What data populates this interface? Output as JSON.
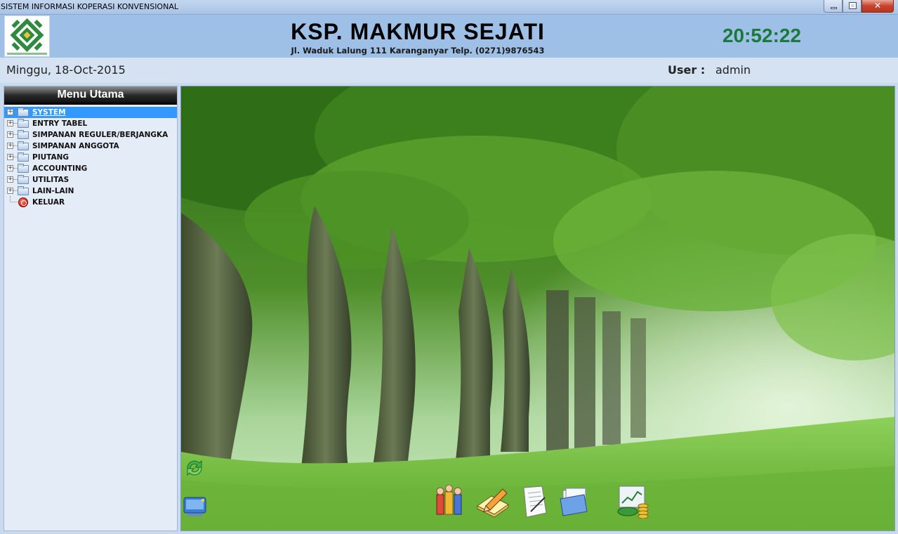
{
  "window": {
    "title": "SISTEM INFORMASI KOPERASI KONVENSIONAL",
    "controls": [
      "minimize",
      "maximize",
      "close"
    ]
  },
  "header": {
    "company": "KSP. MAKMUR SEJATI",
    "address": "Jl. Waduk Lalung 111 Karanganyar Telp. (0271)9876543",
    "clock": "20:52:22"
  },
  "info": {
    "date": "Minggu, 18-Oct-2015",
    "user_label": "User :",
    "user_name": "admin"
  },
  "menu": {
    "title": "Menu Utama",
    "items": [
      {
        "label": "SYSTEM",
        "selected": true
      },
      {
        "label": "ENTRY TABEL"
      },
      {
        "label": "SIMPANAN REGULER/BERJANGKA"
      },
      {
        "label": "SIMPANAN ANGGOTA"
      },
      {
        "label": "PIUTANG"
      },
      {
        "label": "ACCOUNTING"
      },
      {
        "label": "UTILITAS"
      },
      {
        "label": "LAIN-LAIN"
      },
      {
        "label": "KELUAR"
      }
    ]
  },
  "toolbar": {
    "icons": [
      "members-icon",
      "edit-icon",
      "document-icon",
      "folder-icon",
      "finance-chart-icon"
    ]
  },
  "colors": {
    "header_bg": "#9ec0e7",
    "clock": "#1a7a3a",
    "selection": "#3399ff"
  }
}
